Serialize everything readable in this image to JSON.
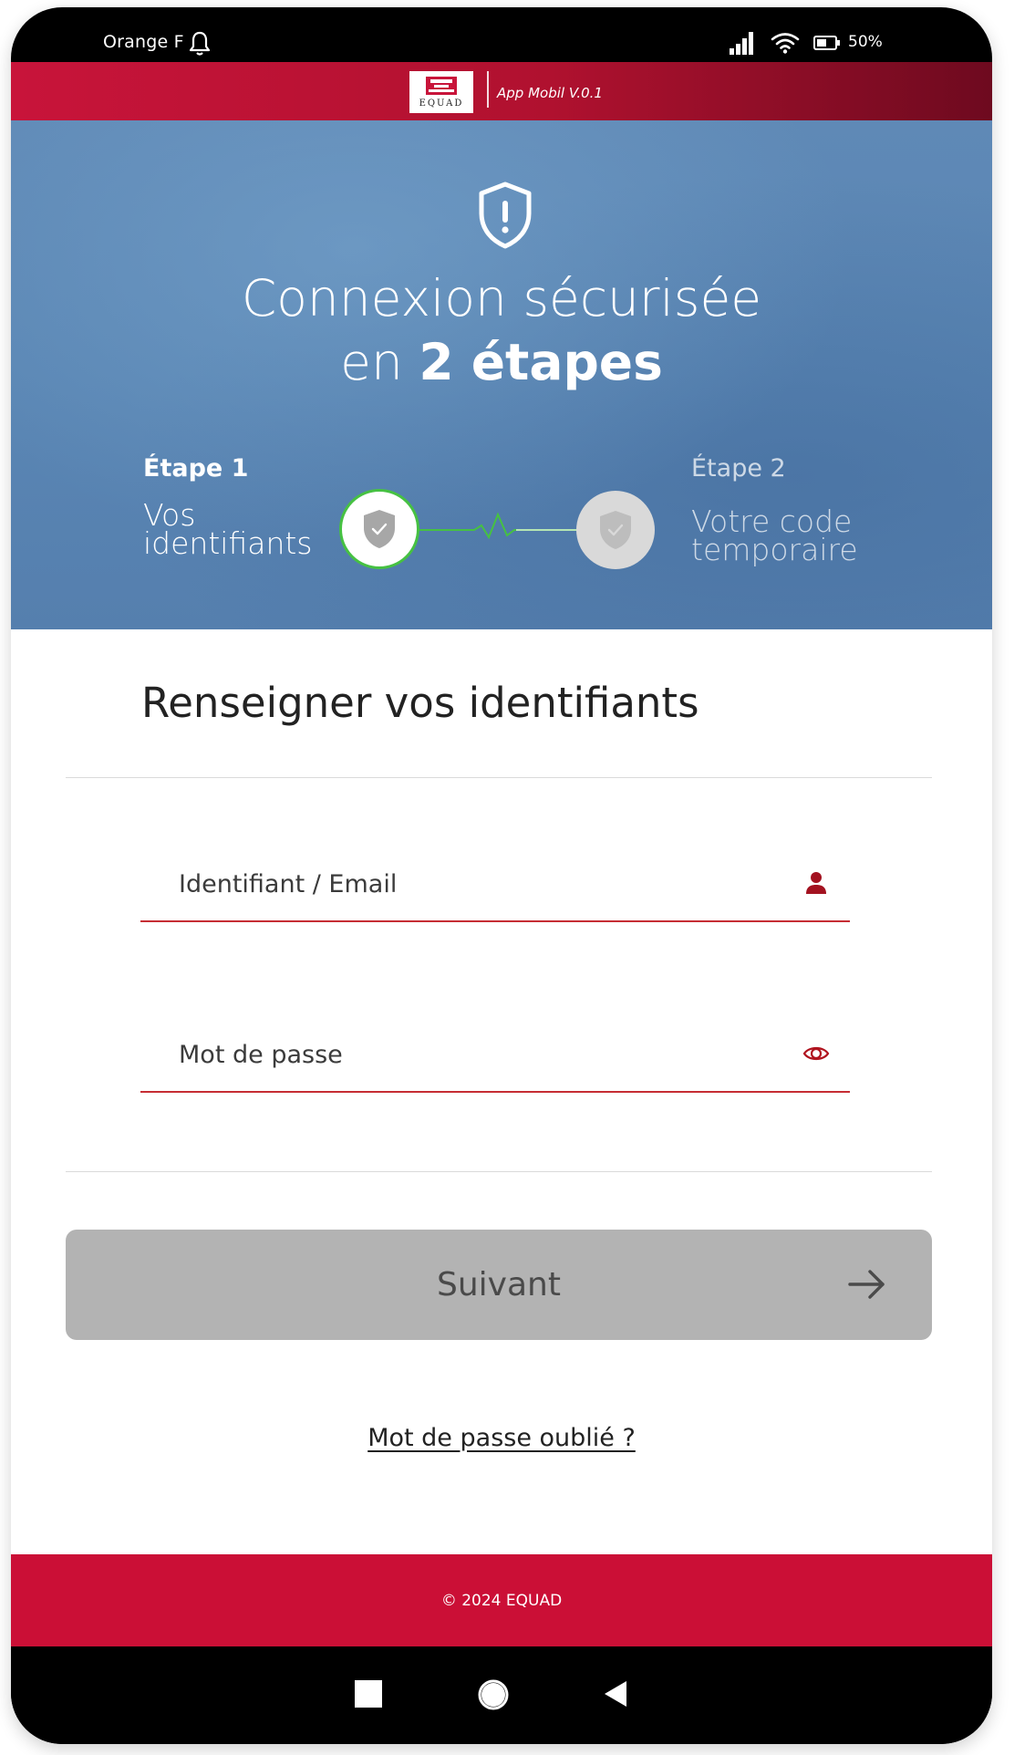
{
  "status_bar": {
    "carrier": "Orange F",
    "battery_percent": "50%",
    "icons": [
      "bell-icon",
      "signal-icon",
      "wifi-icon",
      "battery-icon"
    ]
  },
  "brand": {
    "logo_text": "EQUAD",
    "version": "App Mobil V.0.1",
    "colors": {
      "primary": "#cb0f36",
      "dark": "#6e0a1f"
    }
  },
  "hero": {
    "title_line1": "Connexion sécurisée",
    "title_line2_prefix": "en",
    "title_line2_bold": "2 étapes",
    "steps": [
      {
        "title": "Étape 1",
        "description": "Vos identifiants",
        "state": "active",
        "accent": "#46c142"
      },
      {
        "title": "Étape 2",
        "description": "Votre code temporaire",
        "state": "inactive"
      }
    ]
  },
  "form": {
    "title": "Renseigner vos identifiants",
    "username": {
      "placeholder": "Identifiant / Email",
      "value": "",
      "icon": "user-icon"
    },
    "password": {
      "placeholder": "Mot de passe",
      "value": "",
      "icon": "eye-icon"
    },
    "submit_label": "Suivant",
    "submit_state": "disabled",
    "forgot_link": "Mot de passe oublié ?"
  },
  "footer": {
    "text": "© 2024 EQUAD"
  },
  "nav_bar": {
    "buttons": [
      "recent-apps",
      "home",
      "back"
    ]
  }
}
